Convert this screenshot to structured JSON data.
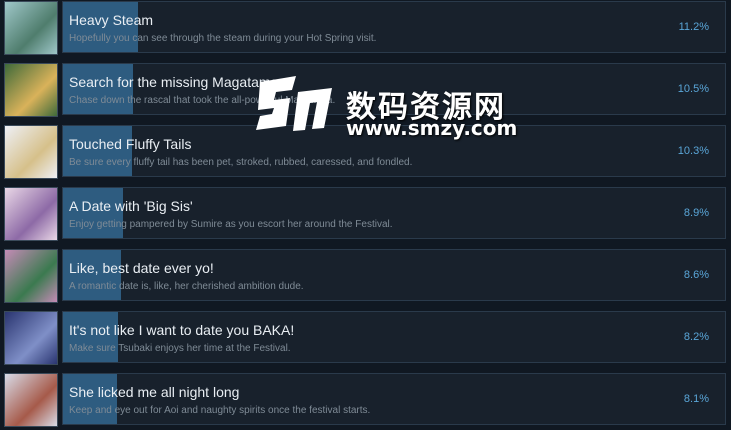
{
  "achievements": [
    {
      "title": "Heavy Steam",
      "description": "Hopefully you can see through the steam during your Hot Spring visit.",
      "percent": "11.2%",
      "fraction": 0.112,
      "thumb_colors": [
        "#9fc7c9",
        "#4f7d6d"
      ]
    },
    {
      "title": "Search for the missing Magatama",
      "description": "Chase down the rascal that took the all-powerful Magatama.",
      "percent": "10.5%",
      "fraction": 0.105,
      "thumb_colors": [
        "#3f6a3a",
        "#d9b25a"
      ]
    },
    {
      "title": "Touched Fluffy Tails",
      "description": "Be sure every fluffy tail has been pet, stroked, rubbed, caressed, and fondled.",
      "percent": "10.3%",
      "fraction": 0.103,
      "thumb_colors": [
        "#eef0f6",
        "#d6c08a"
      ]
    },
    {
      "title": "A Date with 'Big Sis'",
      "description": "Enjoy getting pampered by Sumire as you escort her around the Festival.",
      "percent": "8.9%",
      "fraction": 0.089,
      "thumb_colors": [
        "#e9d7e6",
        "#8d6aa6"
      ]
    },
    {
      "title": "Like, best date ever yo!",
      "description": "A romantic date is, like, her cherished ambition dude.",
      "percent": "8.6%",
      "fraction": 0.086,
      "thumb_colors": [
        "#c48bb6",
        "#3b7a4f"
      ]
    },
    {
      "title": "It's not like I want to date you BAKA!",
      "description": "Make sure Tsubaki enjoys her time at the Festival.",
      "percent": "8.2%",
      "fraction": 0.082,
      "thumb_colors": [
        "#2a3570",
        "#7f8fc7"
      ]
    },
    {
      "title": "She licked me all night long",
      "description": "Keep and eye out for Aoi and naughty spirits once the festival starts.",
      "percent": "8.1%",
      "fraction": 0.081,
      "thumb_colors": [
        "#d8dbe7",
        "#a65a4a"
      ]
    }
  ],
  "watermark": {
    "text_cn": "数码资源网",
    "url": "www.smzy.com",
    "color": "#ffffff"
  },
  "colors": {
    "background": "#101822",
    "card": "#18212c",
    "bar": "#2e5c80",
    "percent": "#5aa6d8"
  }
}
